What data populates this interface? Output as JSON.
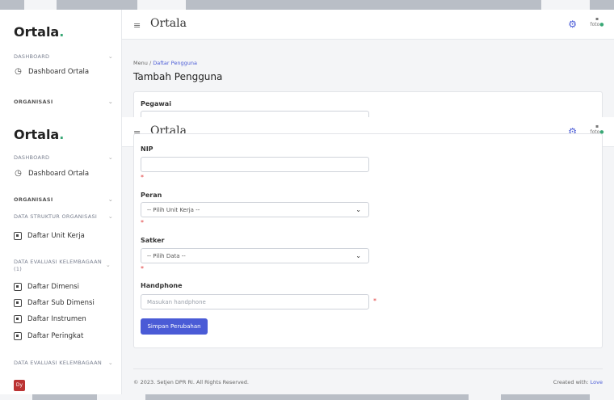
{
  "app": {
    "brand": "Ortala",
    "brand_dot": ".",
    "title": "Ortala"
  },
  "icons": {
    "menu": "≡",
    "gear": "⚙",
    "avatar_alt": "foto",
    "chevron": "⌄",
    "dashboard": "◷"
  },
  "sidebar": {
    "dashboard_section": "DASHBOARD",
    "dashboard_item": "Dashboard Ortala",
    "org_section": "ORGANISASI",
    "struktur_section": "DATA STRUKTUR ORGANISASI",
    "unit_kerja": "Daftar Unit Kerja",
    "evaluasi1_section": "DATA EVALUASI KELEMBAGAAN (1)",
    "dimensi": "Daftar Dimensi",
    "sub_dimensi": "Daftar Sub Dimensi",
    "instrumen": "Daftar Instrumen",
    "peringkat": "Daftar Peringkat",
    "evaluasi2_section": "DATA EVALUASI KELEMBAGAAN",
    "badge": "Dy"
  },
  "breadcrumb": {
    "root": "Menu",
    "sep": "/",
    "current": "Daftar Pengguna"
  },
  "page": {
    "title": "Tambah Pengguna"
  },
  "form": {
    "pegawai_label": "Pegawai",
    "nip_label": "NIP",
    "nip_value": "",
    "peran_label": "Peran",
    "peran_value": "-- Pilih Unit Kerja --",
    "satker_label": "Satker",
    "satker_value": "-- Pilih Data --",
    "handphone_label": "Handphone",
    "handphone_placeholder": "Masukan handphone",
    "required_mark": "*",
    "submit": "Simpan Perubahan"
  },
  "footer": {
    "copyright": "© 2023. Setjen DPR RI. All Rights Reserved.",
    "created": "Created with:",
    "love": "Love"
  }
}
